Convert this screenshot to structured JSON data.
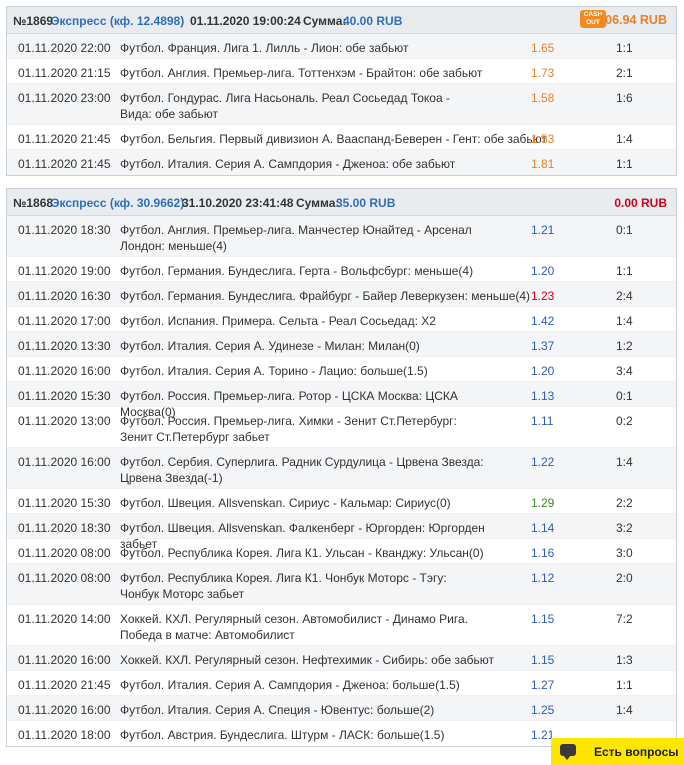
{
  "bets": [
    {
      "number": "№1869",
      "type": "Экспресс (кф. 12.4898)",
      "date": "01.11.2020 19:00:24",
      "sum_label": "Сумма:",
      "sum_value": "40.00 RUB",
      "cashout_label": "CASH OUT",
      "result": "106.94 RUB",
      "result_status": "win",
      "events": [
        {
          "date": "01.11.2020 22:00",
          "event": "Футбол. Франция. Лига 1. Лилль - Лион: обе забьют",
          "odds": "1.65",
          "odds_color": "orange",
          "score": "1:1"
        },
        {
          "date": "01.11.2020 21:15",
          "event": "Футбол. Англия. Премьер-лига. Тоттенхэм - Брайтон: обе забьют",
          "odds": "1.73",
          "odds_color": "orange",
          "score": "2:1"
        },
        {
          "date": "01.11.2020 23:00",
          "event": "Футбол. Гондурас. Лига Насьональ. Реал Сосьедад Токоа - Вида: обе забьют",
          "odds": "1.58",
          "odds_color": "orange",
          "score": "1:6"
        },
        {
          "date": "01.11.2020 21:45",
          "event": "Футбол. Бельгия. Первый дивизион А. Вааспанд-Беверен - Гент: обе забьют",
          "odds": "1.53",
          "odds_color": "orange",
          "score": "1:4"
        },
        {
          "date": "01.11.2020 21:45",
          "event": "Футбол. Италия. Серия А. Сампдория - Дженоа: обе забьют",
          "odds": "1.81",
          "odds_color": "orange",
          "score": "1:1"
        }
      ]
    },
    {
      "number": "№1868",
      "type": "Экспресс (кф. 30.9662)",
      "date": "31.10.2020 23:41:48",
      "sum_label": "Сумма:",
      "sum_value": "35.00 RUB",
      "result": "0.00 RUB",
      "result_status": "lose",
      "events": [
        {
          "date": "01.11.2020 18:30",
          "event": "Футбол. Англия. Премьер-лига. Манчестер Юнайтед - Арсенал Лондон: меньше(4)",
          "odds": "1.21",
          "odds_color": "blue",
          "score": "0:1"
        },
        {
          "date": "01.11.2020 19:00",
          "event": "Футбол. Германия. Бундеслига. Герта - Вольфсбург: меньше(4)",
          "odds": "1.20",
          "odds_color": "blue",
          "score": "1:1"
        },
        {
          "date": "01.11.2020 16:30",
          "event": "Футбол. Германия. Бундеслига. Фрайбург - Байер Леверкузен: меньше(4)",
          "odds": "1.23",
          "odds_color": "red",
          "score": "2:4"
        },
        {
          "date": "01.11.2020 17:00",
          "event": "Футбол. Испания. Примера. Сельта - Реал Сосьедад: Х2",
          "odds": "1.42",
          "odds_color": "blue",
          "score": "1:4"
        },
        {
          "date": "01.11.2020 13:30",
          "event": "Футбол. Италия. Серия А. Удинезе - Милан: Милан(0)",
          "odds": "1.37",
          "odds_color": "blue",
          "score": "1:2"
        },
        {
          "date": "01.11.2020 16:00",
          "event": "Футбол. Италия. Серия А. Торино - Лацио: больше(1.5)",
          "odds": "1.20",
          "odds_color": "blue",
          "score": "3:4"
        },
        {
          "date": "01.11.2020 15:30",
          "event": "Футбол. Россия. Премьер-лига. Ротор - ЦСКА Москва: ЦСКА Москва(0)",
          "odds": "1.13",
          "odds_color": "blue",
          "score": "0:1"
        },
        {
          "date": "01.11.2020 13:00",
          "event": "Футбол. Россия. Премьер-лига. Химки - Зенит Ст.Петербург: Зенит Ст.Петербург забьет",
          "odds": "1.11",
          "odds_color": "blue",
          "score": "0:2"
        },
        {
          "date": "01.11.2020 16:00",
          "event": "Футбол. Сербия. Суперлига. Радник Сурдулица - Црвена Звезда: Црвена Звезда(-1)",
          "odds": "1.22",
          "odds_color": "blue",
          "score": "1:4"
        },
        {
          "date": "01.11.2020 15:30",
          "event": "Футбол. Швеция. Allsvenskan. Сириус - Кальмар: Сириус(0)",
          "odds": "1.29",
          "odds_color": "green",
          "score": "2:2"
        },
        {
          "date": "01.11.2020 18:30",
          "event": "Футбол. Швеция. Allsvenskan. Фалкенберг - Юргорден: Юргорден забьет",
          "odds": "1.14",
          "odds_color": "blue",
          "score": "3:2"
        },
        {
          "date": "01.11.2020 08:00",
          "event": "Футбол. Республика Корея. Лига К1. Ульсан - Кванджу: Ульсан(0)",
          "odds": "1.16",
          "odds_color": "blue",
          "score": "3:0"
        },
        {
          "date": "01.11.2020 08:00",
          "event": "Футбол. Республика Корея. Лига К1. Чонбук Моторс - Тэгу: Чонбук Моторс забьет",
          "odds": "1.12",
          "odds_color": "blue",
          "score": "2:0"
        },
        {
          "date": "01.11.2020 14:00",
          "event": "Хоккей. КХЛ. Регулярный сезон. Автомобилист - Динамо Рига. Победа в матче: Автомобилист",
          "odds": "1.15",
          "odds_color": "blue",
          "score": "7:2"
        },
        {
          "date": "01.11.2020 16:00",
          "event": "Хоккей. КХЛ. Регулярный сезон. Нефтехимик - Сибирь: обе забьют",
          "odds": "1.15",
          "odds_color": "blue",
          "score": "1:3"
        },
        {
          "date": "01.11.2020 21:45",
          "event": "Футбол. Италия. Серия А. Сампдория - Дженоа: больше(1.5)",
          "odds": "1.27",
          "odds_color": "blue",
          "score": "1:1"
        },
        {
          "date": "01.11.2020 16:00",
          "event": "Футбол. Италия. Серия А. Специя - Ювентус: больше(2)",
          "odds": "1.25",
          "odds_color": "blue",
          "score": "1:4"
        },
        {
          "date": "01.11.2020 18:00",
          "event": "Футбол. Австрия. Бундеслига. Штурм - ЛАСК: больше(1.5)",
          "odds": "1.21",
          "odds_color": "blue",
          "score": ""
        }
      ]
    }
  ],
  "help_widget": {
    "label": "Есть вопросы"
  },
  "colors": {
    "orange": "#e8812a",
    "blue": "#2b5cb8",
    "red": "#d0021b",
    "green": "#3a8a2a",
    "help_bg": "#ffe600"
  }
}
